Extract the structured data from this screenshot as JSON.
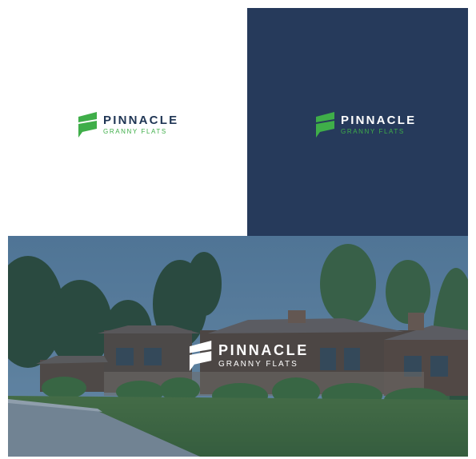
{
  "brand": {
    "title": "PINNACLE",
    "subtitle": "GRANNY FLATS",
    "green": "#3fae49",
    "navy": "#263a5b",
    "white": "#ffffff"
  },
  "photo": {
    "subject": "house-icon"
  }
}
